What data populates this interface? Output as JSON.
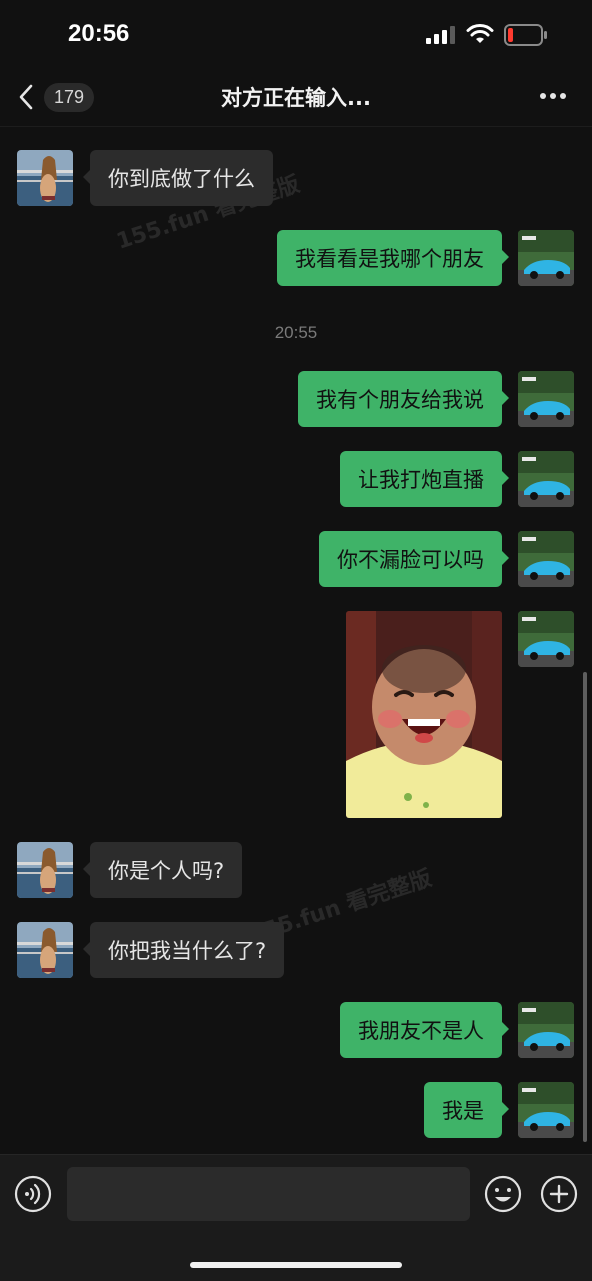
{
  "status_bar": {
    "time": "20:56",
    "icons": [
      "cellular-signal-icon",
      "wifi-icon",
      "battery-low-icon"
    ]
  },
  "nav": {
    "back_icon": "chevron-left-icon",
    "unread_count": "179",
    "title": "对方正在输入...",
    "more_icon": "more-horizontal-icon"
  },
  "chat": {
    "messages": [
      {
        "side": "in",
        "type": "text",
        "text": "你到底做了什么"
      },
      {
        "side": "out",
        "type": "text",
        "text": "我看看是我哪个朋友"
      },
      {
        "type": "time",
        "text": "20:55"
      },
      {
        "side": "out",
        "type": "text",
        "text": "我有个朋友给我说"
      },
      {
        "side": "out",
        "type": "text",
        "text": "让我打炮直播"
      },
      {
        "side": "out",
        "type": "text",
        "text": "你不漏脸可以吗"
      },
      {
        "side": "out",
        "type": "sticker",
        "image": "laughing-child-sticker"
      },
      {
        "side": "in",
        "type": "text",
        "text": "你是个人吗?"
      },
      {
        "side": "in",
        "type": "text",
        "text": "你把我当什么了?"
      },
      {
        "side": "out",
        "type": "text",
        "text": "我朋友不是人"
      },
      {
        "side": "out",
        "type": "text",
        "text": "我是"
      }
    ],
    "watermarks": [
      "155.fun 看完整版",
      "155.fun 看完整版"
    ]
  },
  "input_bar": {
    "voice_icon": "voice-input-icon",
    "emoji_icon": "emoji-icon",
    "plus_icon": "add-more-icon",
    "input_value": "",
    "input_placeholder": ""
  },
  "colors": {
    "background": "#111111",
    "incoming_bubble": "#2c2c2c",
    "outgoing_bubble": "#3fb368",
    "battery_low": "#ff3b30"
  }
}
